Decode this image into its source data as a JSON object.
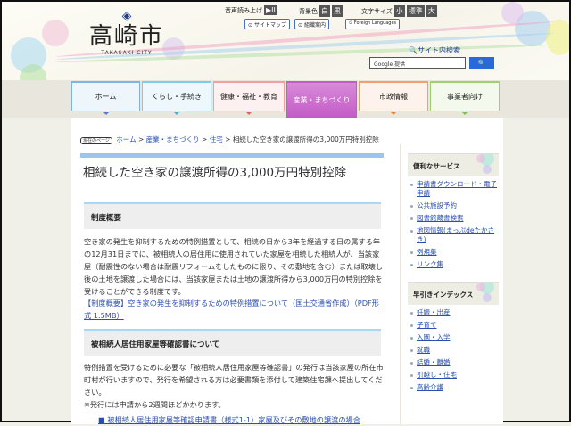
{
  "header": {
    "logo_name": "高崎市",
    "logo_en": "TAKASAKI CITY",
    "voice_label": "音声読み上げ",
    "voice_btn": "▶II",
    "bg_label": "背景色",
    "bg_white": "白",
    "bg_black": "黒",
    "size_label": "文字サイズ",
    "size_small": "小",
    "size_std": "標準",
    "size_large": "大",
    "sitemap": "サイトマップ",
    "org": "組織案内",
    "foreign": "Foreign Languages",
    "search_label": "サイト内検索",
    "search_placeholder": "Google 提供",
    "search_btn": "🔍"
  },
  "nav": [
    {
      "label": "ホーム",
      "color": "#7fb3e0"
    },
    {
      "label": "くらし・手続き",
      "color": "#7fcbe8"
    },
    {
      "label": "健康・福祉・教育",
      "color": "#f0a0a0"
    },
    {
      "label": "産業・まちづくり",
      "color": "#c45cc8"
    },
    {
      "label": "市政情報",
      "color": "#f0a070"
    },
    {
      "label": "事業者向け",
      "color": "#a0d070"
    }
  ],
  "breadcrumb": {
    "here": "現在のページ",
    "items": [
      "ホーム",
      "産業・まちづくり",
      "住宅"
    ],
    "current": "相続した空き家の譲渡所得の3,000万円特別控除",
    "sep": ">"
  },
  "main": {
    "title": "相続した空き家の譲渡所得の3,000万円特別控除",
    "sections": [
      {
        "heading": "制度概要",
        "body": "空き家の発生を抑制するための特例措置として、相続の日から3年を経過する日の属する年の12月31日までに、被相続人の居住用に使用されていた家屋を相続した相続人が、当該家屋（耐震性のない場合は耐震リフォームをしたものに限り、その敷地を含む）または取壊し後の土地を譲渡した場合には、当該家屋または土地の譲渡所得から3,000万円の特別控除を受けることができる制度です。",
        "link": "【制度概要】空き家の発生を抑制するための特例措置について（国土交通省作成）（PDF形式 1.5MB）"
      },
      {
        "heading": "被相続人居住用家屋等確認書について",
        "body": "特例措置を受けるために必要な「被相続人居住用家屋等確認書」の発行は当該家屋の所在市町村が行いますので、発行を希望される方は必要書類を添付して建築住宅課へ提出してください。",
        "note": "※発行には申請から2週間ほどかかります。",
        "item": "■ 被相続人居住用家屋等確認申請書（様式1-1）家屋及びその敷地の譲渡の場合"
      }
    ]
  },
  "sidebar": {
    "services_title": "便利なサービス",
    "services": [
      "申請書ダウンロード・電子申請",
      "公共施設予約",
      "図書館蔵書検索",
      "地図情報(まっぷdeたかさき)",
      "例規集",
      "リンク集"
    ],
    "index_title": "早引きインデックス",
    "index": [
      "妊娠・出産",
      "子育て",
      "入園・入学",
      "就職",
      "結婚・離婚",
      "引越し・住宅",
      "高齢介護"
    ]
  }
}
